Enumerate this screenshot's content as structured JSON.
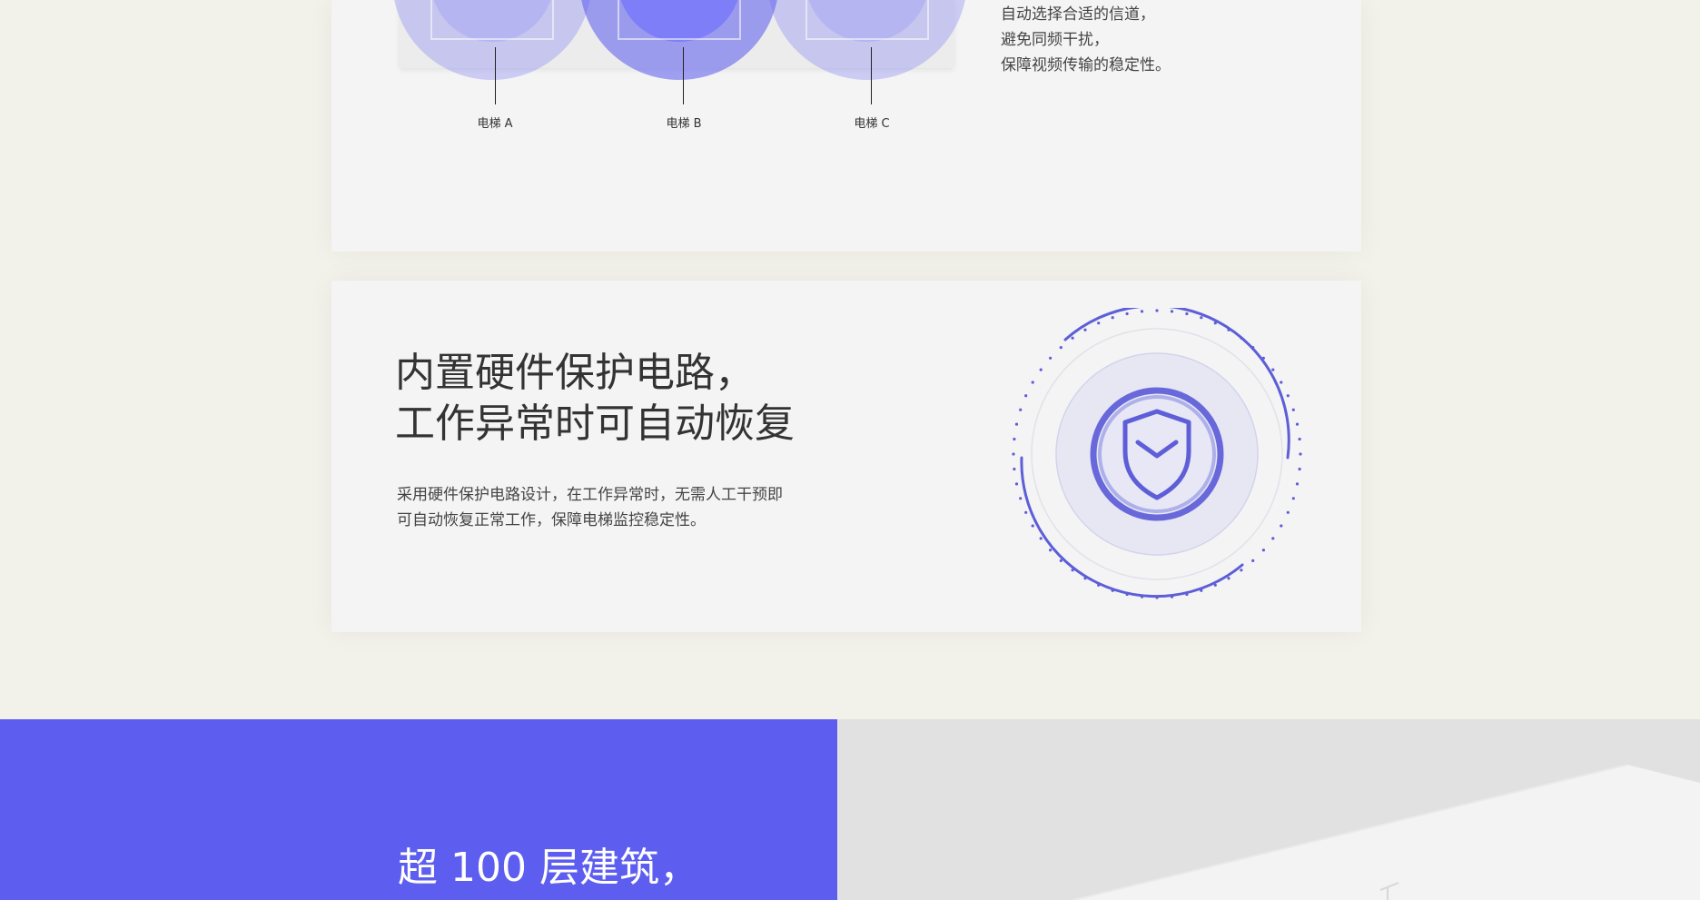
{
  "channel_section": {
    "elevators": [
      {
        "label": "电梯 A"
      },
      {
        "label": "电梯 B"
      },
      {
        "label": "电梯 C"
      }
    ],
    "description_lines": [
      "自动选择合适的信道，",
      "避免同频干扰，",
      "保障视频传输的稳定性。"
    ]
  },
  "protection_section": {
    "title_lines": [
      "内置硬件保护电路，",
      "工作异常时可自动恢复"
    ],
    "description_lines": [
      "采用硬件保护电路设计，在工作异常时，无需人工干预即",
      "可自动恢复正常工作，保障电梯监控稳定性。"
    ],
    "icon": "shield-check-icon",
    "accent_color": "#5d5ed8"
  },
  "building_section": {
    "title": "超 100 层建筑，",
    "band_color": "#5d5eef"
  }
}
